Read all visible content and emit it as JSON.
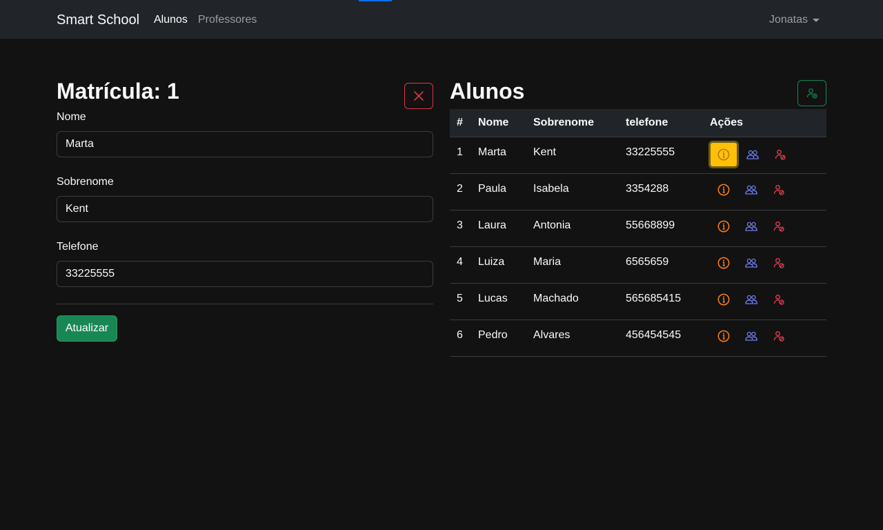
{
  "navbar": {
    "brand": "Smart School",
    "links": [
      {
        "label": "Alunos",
        "active": true
      },
      {
        "label": "Professores",
        "active": false
      }
    ],
    "user": "Jonatas"
  },
  "form": {
    "title": "Matrícula: 1",
    "fields": [
      {
        "label": "Nome",
        "value": "Marta"
      },
      {
        "label": "Sobrenome",
        "value": "Kent"
      },
      {
        "label": "Telefone",
        "value": "33225555"
      }
    ],
    "submit_label": "Atualizar",
    "close_icon": "x-icon"
  },
  "table": {
    "title": "Alunos",
    "add_icon": "person-add-icon",
    "headers": [
      "#",
      "Nome",
      "Sobrenome",
      "telefone",
      "Ações"
    ],
    "rows": [
      {
        "id": "1",
        "nome": "Marta",
        "sobrenome": "Kent",
        "telefone": "33225555",
        "selected": true
      },
      {
        "id": "2",
        "nome": "Paula",
        "sobrenome": "Isabela",
        "telefone": "3354288",
        "selected": false
      },
      {
        "id": "3",
        "nome": "Laura",
        "sobrenome": "Antonia",
        "telefone": "55668899",
        "selected": false
      },
      {
        "id": "4",
        "nome": "Luiza",
        "sobrenome": "Maria",
        "telefone": "6565659",
        "selected": false
      },
      {
        "id": "5",
        "nome": "Lucas",
        "sobrenome": "Machado",
        "telefone": "565685415",
        "selected": false
      },
      {
        "id": "6",
        "nome": "Pedro",
        "sobrenome": "Alvares",
        "telefone": "456454545",
        "selected": false
      }
    ],
    "action_icons": [
      "info-icon",
      "people-icon",
      "person-remove-icon"
    ]
  },
  "colors": {
    "background": "#121212",
    "navbar": "#212529",
    "primary_accent": "#0d6efd",
    "success": "#198754",
    "danger": "#dc3545",
    "warning": "#ffc107",
    "info_icon": "#fd7e14",
    "people_icon": "#6f7ff7",
    "remove_icon": "#ea3b4f"
  }
}
